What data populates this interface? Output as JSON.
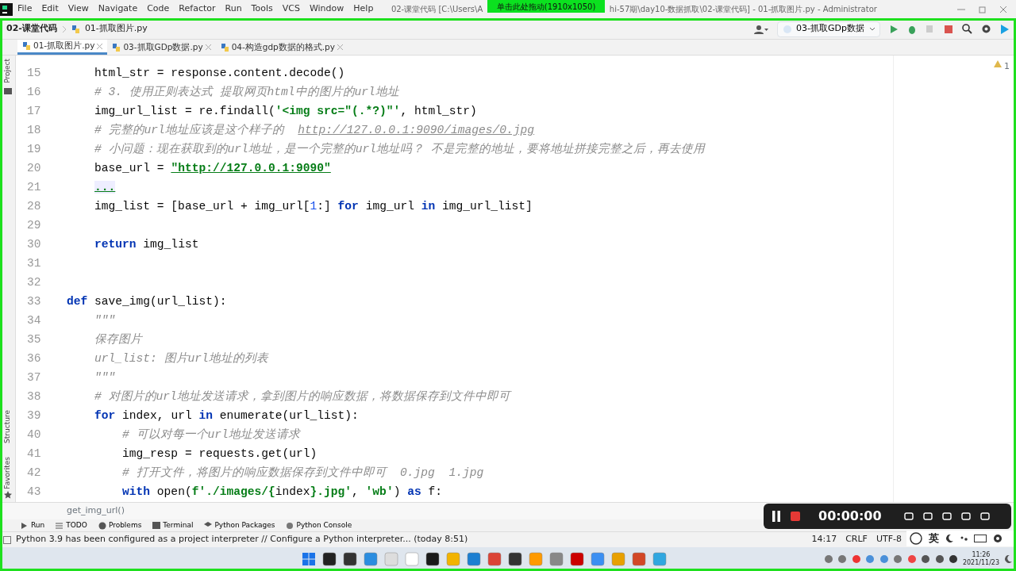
{
  "menu": [
    "File",
    "Edit",
    "View",
    "Navigate",
    "Code",
    "Refactor",
    "Run",
    "Tools",
    "VCS",
    "Window",
    "Help"
  ],
  "window": {
    "title_left": "02-课堂代码 [C:\\Users\\A",
    "title_right": "hi-57期\\day10-数据抓取\\02-课堂代码] - 01-抓取图片.py - Administrator"
  },
  "recorder_handle": "单击此处拖动(1910x1050)",
  "breadcrumb": [
    "02-课堂代码",
    "01-抓取图片.py"
  ],
  "run_config": "03-抓取GDp数据",
  "tabs": [
    {
      "label": "01-抓取图片.py",
      "selected": true
    },
    {
      "label": "03-抓取GDp数据.py",
      "selected": false
    },
    {
      "label": "04-构造gdp数据的格式.py",
      "selected": false
    }
  ],
  "side_tabs": [
    "Project",
    "Structure",
    "Favorites"
  ],
  "inspection": "1",
  "code": [
    {
      "number": "15",
      "segments": [
        {
          "kind": "plain",
          "text": "    html_str = response.content.decode()"
        }
      ]
    },
    {
      "number": "16",
      "segments": [
        {
          "kind": "comment",
          "text": "    # 3. 使用正则表达式 提取网页html中的图片的url地址"
        }
      ]
    },
    {
      "number": "17",
      "segments": [
        {
          "kind": "plain",
          "text": "    img_url_list = re.findall("
        },
        {
          "kind": "string",
          "text": "'<img src=\"(.*?)\"'"
        },
        {
          "kind": "plain",
          "text": ", html_str)"
        }
      ]
    },
    {
      "number": "18",
      "segments": [
        {
          "kind": "comment",
          "text": "    # 完整的url地址应该是这个样子的  "
        },
        {
          "kind": "link",
          "text": "http://127.0.0.1:9090/images/0.jpg"
        }
      ]
    },
    {
      "number": "19",
      "segments": [
        {
          "kind": "comment",
          "text": "    # 小问题：现在获取到的url地址，是一个完整的url地址吗？ 不是完整的地址，要将地址拼接完整之后，再去使用"
        }
      ]
    },
    {
      "number": "20",
      "segments": [
        {
          "kind": "plain",
          "text": "    base_url = "
        },
        {
          "kind": "stringlink",
          "text": "\"http://127.0.0.1:9090\""
        }
      ]
    },
    {
      "number": "21",
      "segments": [
        {
          "kind": "folded",
          "text": "    ..."
        }
      ]
    },
    {
      "number": "28",
      "segments": [
        {
          "kind": "plain",
          "text": "    img_list = [base_url + img_url["
        },
        {
          "kind": "number",
          "text": "1"
        },
        {
          "kind": "plain",
          "text": ":] "
        },
        {
          "kind": "keyword",
          "text": "for"
        },
        {
          "kind": "plain",
          "text": " img_url "
        },
        {
          "kind": "keyword",
          "text": "in"
        },
        {
          "kind": "plain",
          "text": " img_url_list]"
        }
      ]
    },
    {
      "number": "29"
    },
    {
      "number": "30",
      "segments": [
        {
          "kind": "keyword",
          "text": "    return"
        },
        {
          "kind": "plain",
          "text": " img_list"
        }
      ]
    },
    {
      "number": "31"
    },
    {
      "number": "32"
    },
    {
      "number": "33",
      "segments": [
        {
          "kind": "keyword",
          "text": "def"
        },
        {
          "kind": "plain",
          "text": " save_img(url_list):"
        }
      ]
    },
    {
      "number": "34",
      "segments": [
        {
          "kind": "doc",
          "text": "    \"\"\""
        }
      ]
    },
    {
      "number": "35",
      "segments": [
        {
          "kind": "doc",
          "text": "    保存图片"
        }
      ]
    },
    {
      "number": "36",
      "segments": [
        {
          "kind": "doc",
          "text": "    url_list: 图片url地址的列表"
        }
      ]
    },
    {
      "number": "37",
      "segments": [
        {
          "kind": "doc",
          "text": "    \"\"\""
        }
      ]
    },
    {
      "number": "38",
      "segments": [
        {
          "kind": "comment",
          "text": "    # 对图片的url地址发送请求，拿到图片的响应数据，将数据保存到文件中即可"
        }
      ]
    },
    {
      "number": "39",
      "segments": [
        {
          "kind": "keyword",
          "text": "    for"
        },
        {
          "kind": "plain",
          "text": " index, url "
        },
        {
          "kind": "keyword",
          "text": "in"
        },
        {
          "kind": "plain",
          "text": " enumerate(url_list):"
        }
      ]
    },
    {
      "number": "40",
      "segments": [
        {
          "kind": "comment",
          "text": "        # 可以对每一个url地址发送请求"
        }
      ]
    },
    {
      "number": "41",
      "segments": [
        {
          "kind": "plain",
          "text": "        img_resp = requests.get(url)"
        }
      ]
    },
    {
      "number": "42",
      "segments": [
        {
          "kind": "comment",
          "text": "        # 打开文件，将图片的响应数据保存到文件中即可  0.jpg  1.jpg"
        }
      ]
    },
    {
      "number": "43",
      "segments": [
        {
          "kind": "keyword",
          "text": "        with"
        },
        {
          "kind": "plain",
          "text": " open("
        },
        {
          "kind": "string",
          "text": "f'./images/{"
        },
        {
          "kind": "plain",
          "text": "index"
        },
        {
          "kind": "string",
          "text": "}.jpg'"
        },
        {
          "kind": "plain",
          "text": ", "
        },
        {
          "kind": "string",
          "text": "'wb'"
        },
        {
          "kind": "plain",
          "text": ") "
        },
        {
          "kind": "keyword",
          "text": "as"
        },
        {
          "kind": "plain",
          "text": " f:"
        }
      ]
    }
  ],
  "code_breadcrumb": "get_img_url()",
  "tool_windows": [
    "Run",
    "TODO",
    "Problems",
    "Terminal",
    "Python Packages",
    "Python Console"
  ],
  "status_bar": {
    "message": "Python 3.9 has been configured as a project interpreter // Configure a Python interpreter... (today 8:51)",
    "position": "14:17",
    "line_separator": "CRLF",
    "encoding": "UTF-8"
  },
  "recorder": {
    "time": "00:00:00"
  },
  "ime": {
    "mode": "英"
  },
  "taskbar": {
    "time": "11:26",
    "date": "2021/11/23"
  }
}
